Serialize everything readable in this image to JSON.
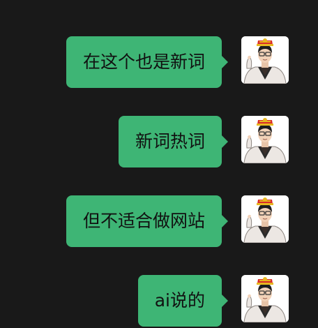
{
  "chat": {
    "messages": [
      {
        "text": "在这个也是新词",
        "sender": "self",
        "avatar_icon": "user-avatar-cartoon"
      },
      {
        "text": "新词热词",
        "sender": "self",
        "avatar_icon": "user-avatar-cartoon"
      },
      {
        "text": "但不适合做网站",
        "sender": "self",
        "avatar_icon": "user-avatar-cartoon"
      },
      {
        "text": "ai说的",
        "sender": "self",
        "avatar_icon": "user-avatar-cartoon"
      }
    ]
  },
  "colors": {
    "background": "#191919",
    "bubble": "#3eb575",
    "bubble_text": "#111111",
    "avatar_background": "#ffffff"
  }
}
